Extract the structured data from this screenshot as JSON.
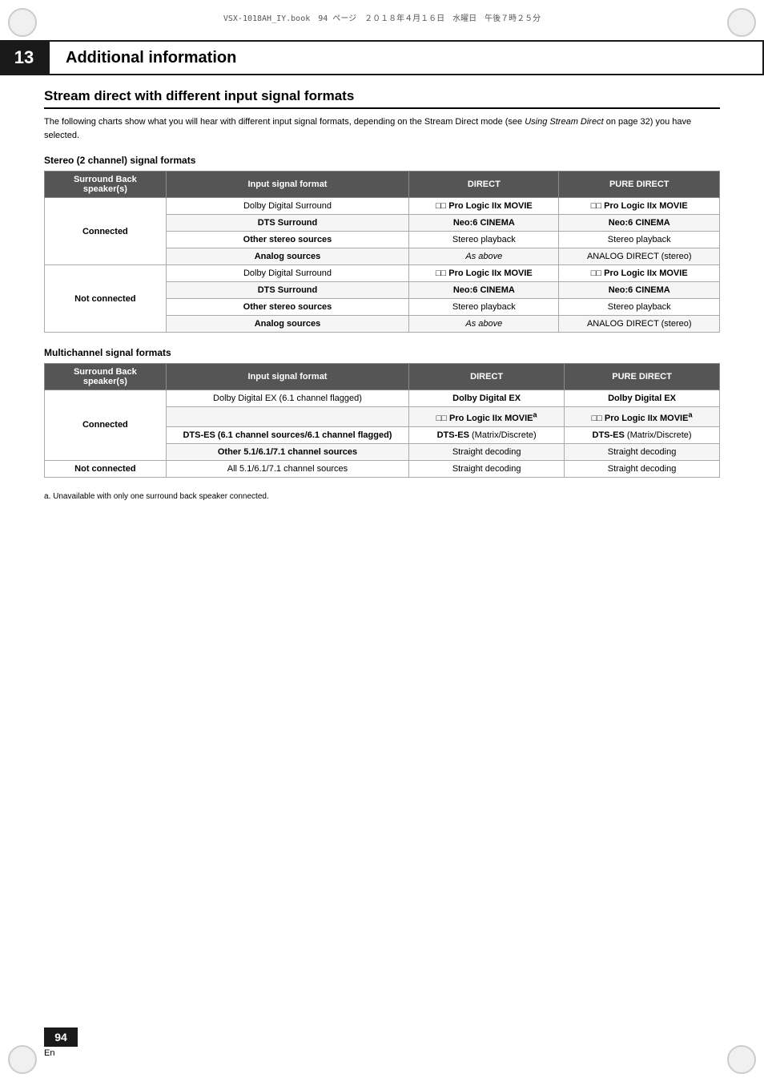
{
  "topbar": {
    "text": "VSX-1018AH_IY.book　94 ページ　２０１８年４月１６日　水曜日　午後７時２５分"
  },
  "chapter": {
    "number": "13",
    "title": "Additional information"
  },
  "section": {
    "title": "Stream direct with different input signal formats",
    "description": "The following charts show what you will hear with different input signal formats, depending on the Stream Direct mode (see ",
    "description_italic": "Using Stream Direct",
    "description_end": " on page 32) you have selected."
  },
  "stereo_table": {
    "subsection": "Stereo (2 channel) signal formats",
    "headers": [
      "Surround Back speaker(s)",
      "Input signal format",
      "DIRECT",
      "PURE DIRECT"
    ],
    "rows": [
      {
        "speaker": "Connected",
        "rowspan": 4,
        "inputs": [
          {
            "format": "Dolby Digital Surround",
            "direct": "□□ Pro Logic IIx MOVIE",
            "pure_direct": "□□ Pro Logic IIx MOVIE",
            "direct_bold": true,
            "pure_direct_bold": true
          },
          {
            "format": "DTS Surround",
            "direct": "Neo:6 CINEMA",
            "pure_direct": "Neo:6 CINEMA",
            "direct_bold": true,
            "pure_direct_bold": true
          },
          {
            "format": "Other stereo sources",
            "direct": "Stereo playback",
            "pure_direct": "Stereo playback",
            "direct_bold": false,
            "pure_direct_bold": false
          },
          {
            "format": "Analog sources",
            "direct": "As above",
            "direct_italic": true,
            "pure_direct": "ANALOG DIRECT (stereo)",
            "pure_direct_bold": false
          }
        ]
      },
      {
        "speaker": "Not connected",
        "rowspan": 4,
        "inputs": [
          {
            "format": "Dolby Digital Surround",
            "direct": "□□ Pro Logic IIx MOVIE",
            "pure_direct": "□□ Pro Logic IIx MOVIE",
            "direct_bold": true,
            "pure_direct_bold": true
          },
          {
            "format": "DTS Surround",
            "direct": "Neo:6 CINEMA",
            "pure_direct": "Neo:6 CINEMA",
            "direct_bold": true,
            "pure_direct_bold": true
          },
          {
            "format": "Other stereo sources",
            "direct": "Stereo playback",
            "pure_direct": "Stereo playback"
          },
          {
            "format": "Analog sources",
            "direct": "As above",
            "direct_italic": true,
            "pure_direct": "ANALOG DIRECT (stereo)"
          }
        ]
      }
    ]
  },
  "multichannel_table": {
    "subsection": "Multichannel signal formats",
    "headers": [
      "Surround Back speaker(s)",
      "Input signal format",
      "DIRECT",
      "PURE DIRECT"
    ],
    "rows": [
      {
        "speaker": "Connected",
        "rowspan": 3,
        "inputs": [
          {
            "format": "Dolby Digital EX (6.1 channel flagged)",
            "direct": "Dolby Digital EX",
            "pure_direct": "Dolby Digital EX",
            "direct_bold": true,
            "pure_direct_bold": true
          },
          {
            "format": "",
            "direct": "□□ Pro Logic IIx MOVIEa",
            "pure_direct": "□□ Pro Logic IIx MOVIEa",
            "direct_bold": true,
            "pure_direct_bold": true
          },
          {
            "format": "DTS-ES (6.1 channel sources/6.1 channel flagged)",
            "direct": "DTS-ES (Matrix/Discrete)",
            "pure_direct": "DTS-ES (Matrix/Discrete)",
            "direct_bold": true,
            "pure_direct_bold": true
          },
          {
            "format": "Other 5.1/6.1/7.1 channel sources",
            "direct": "Straight decoding",
            "pure_direct": "Straight decoding"
          }
        ]
      },
      {
        "speaker": "Not connected",
        "rowspan": 1,
        "inputs": [
          {
            "format": "All 5.1/6.1/7.1 channel sources",
            "direct": "Straight decoding",
            "pure_direct": "Straight decoding"
          }
        ]
      }
    ]
  },
  "footnote": "a. Unavailable with only one surround back speaker connected.",
  "page": {
    "number": "94",
    "lang": "En"
  }
}
